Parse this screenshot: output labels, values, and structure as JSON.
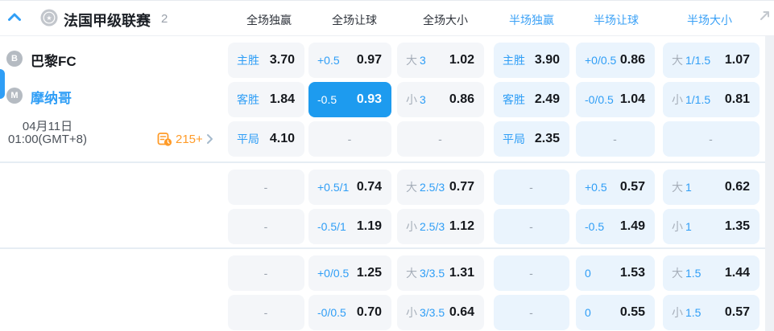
{
  "colors": {
    "accent_blue": "#2f9ef6",
    "selected_cell_bg": "#1d9bef",
    "fulltime_cell_bg": "#f4f6f9",
    "halftime_cell_bg": "#eaf4fd",
    "odds_text": "#15181d",
    "orange": "#ff9b28"
  },
  "header": {
    "league_name": "法国甲级联赛",
    "match_count": "2",
    "columns": [
      {
        "label": "全场独赢",
        "tone": "dark"
      },
      {
        "label": "全场让球",
        "tone": "dark"
      },
      {
        "label": "全场大小",
        "tone": "dark"
      },
      {
        "label": "半场独赢",
        "tone": "blue"
      },
      {
        "label": "半场让球",
        "tone": "blue"
      },
      {
        "label": "半场大小",
        "tone": "blue"
      }
    ]
  },
  "match": {
    "home_initial": "B",
    "home_name": "巴黎FC",
    "away_initial": "M",
    "away_name": "摩纳哥",
    "date": "04月11日",
    "time": "01:00(GMT+8)",
    "more_markets": "215+"
  },
  "groups": [
    {
      "rows": [
        {
          "cells": [
            {
              "t": "lo",
              "label": "主胜",
              "odds": "3.70"
            },
            {
              "t": "ho",
              "line": "+0.5",
              "odds": "0.97"
            },
            {
              "t": "po",
              "prefix": "大",
              "line": "3",
              "odds": "1.02"
            },
            {
              "t": "lo",
              "label": "主胜",
              "odds": "3.90"
            },
            {
              "t": "ho",
              "line": "+0/0.5",
              "odds": "0.86"
            },
            {
              "t": "po",
              "prefix": "大",
              "line": "1/1.5",
              "odds": "1.07"
            }
          ]
        },
        {
          "cells": [
            {
              "t": "lo",
              "label": "客胜",
              "odds": "1.84"
            },
            {
              "t": "ho",
              "line": "-0.5",
              "odds": "0.93",
              "sel": true
            },
            {
              "t": "po",
              "prefix": "小",
              "line": "3",
              "odds": "0.86"
            },
            {
              "t": "lo",
              "label": "客胜",
              "odds": "2.49"
            },
            {
              "t": "ho",
              "line": "-0/0.5",
              "odds": "1.04"
            },
            {
              "t": "po",
              "prefix": "小",
              "line": "1/1.5",
              "odds": "0.81"
            }
          ]
        },
        {
          "cells": [
            {
              "t": "lo",
              "label": "平局",
              "odds": "4.10"
            },
            {
              "t": "dash",
              "mark": "-"
            },
            {
              "t": "dash",
              "mark": "-"
            },
            {
              "t": "lo",
              "label": "平局",
              "odds": "2.35"
            },
            {
              "t": "dash",
              "mark": "-"
            },
            {
              "t": "dash",
              "mark": "-"
            }
          ]
        }
      ]
    },
    {
      "rows": [
        {
          "cells": [
            {
              "t": "dash",
              "mark": "-"
            },
            {
              "t": "ho",
              "line": "+0.5/1",
              "odds": "0.74"
            },
            {
              "t": "po",
              "prefix": "大",
              "line": "2.5/3",
              "odds": "0.77"
            },
            {
              "t": "dash",
              "mark": "-"
            },
            {
              "t": "ho",
              "line": "+0.5",
              "odds": "0.57"
            },
            {
              "t": "po",
              "prefix": "大",
              "line": "1",
              "odds": "0.62"
            }
          ]
        },
        {
          "cells": [
            {
              "t": "dash",
              "mark": "-"
            },
            {
              "t": "ho",
              "line": "-0.5/1",
              "odds": "1.19"
            },
            {
              "t": "po",
              "prefix": "小",
              "line": "2.5/3",
              "odds": "1.12"
            },
            {
              "t": "dash",
              "mark": "-"
            },
            {
              "t": "ho",
              "line": "-0.5",
              "odds": "1.49"
            },
            {
              "t": "po",
              "prefix": "小",
              "line": "1",
              "odds": "1.35"
            }
          ]
        }
      ]
    },
    {
      "rows": [
        {
          "cells": [
            {
              "t": "dash",
              "mark": "-"
            },
            {
              "t": "ho",
              "line": "+0/0.5",
              "odds": "1.25"
            },
            {
              "t": "po",
              "prefix": "大",
              "line": "3/3.5",
              "odds": "1.31"
            },
            {
              "t": "dash",
              "mark": "-"
            },
            {
              "t": "ho",
              "line": "0",
              "odds": "1.53"
            },
            {
              "t": "po",
              "prefix": "大",
              "line": "1.5",
              "odds": "1.44"
            }
          ]
        },
        {
          "cells": [
            {
              "t": "dash",
              "mark": "-"
            },
            {
              "t": "ho",
              "line": "-0/0.5",
              "odds": "0.70"
            },
            {
              "t": "po",
              "prefix": "小",
              "line": "3/3.5",
              "odds": "0.64"
            },
            {
              "t": "dash",
              "mark": "-"
            },
            {
              "t": "ho",
              "line": "0",
              "odds": "0.55"
            },
            {
              "t": "po",
              "prefix": "小",
              "line": "1.5",
              "odds": "0.57"
            }
          ]
        }
      ]
    }
  ]
}
